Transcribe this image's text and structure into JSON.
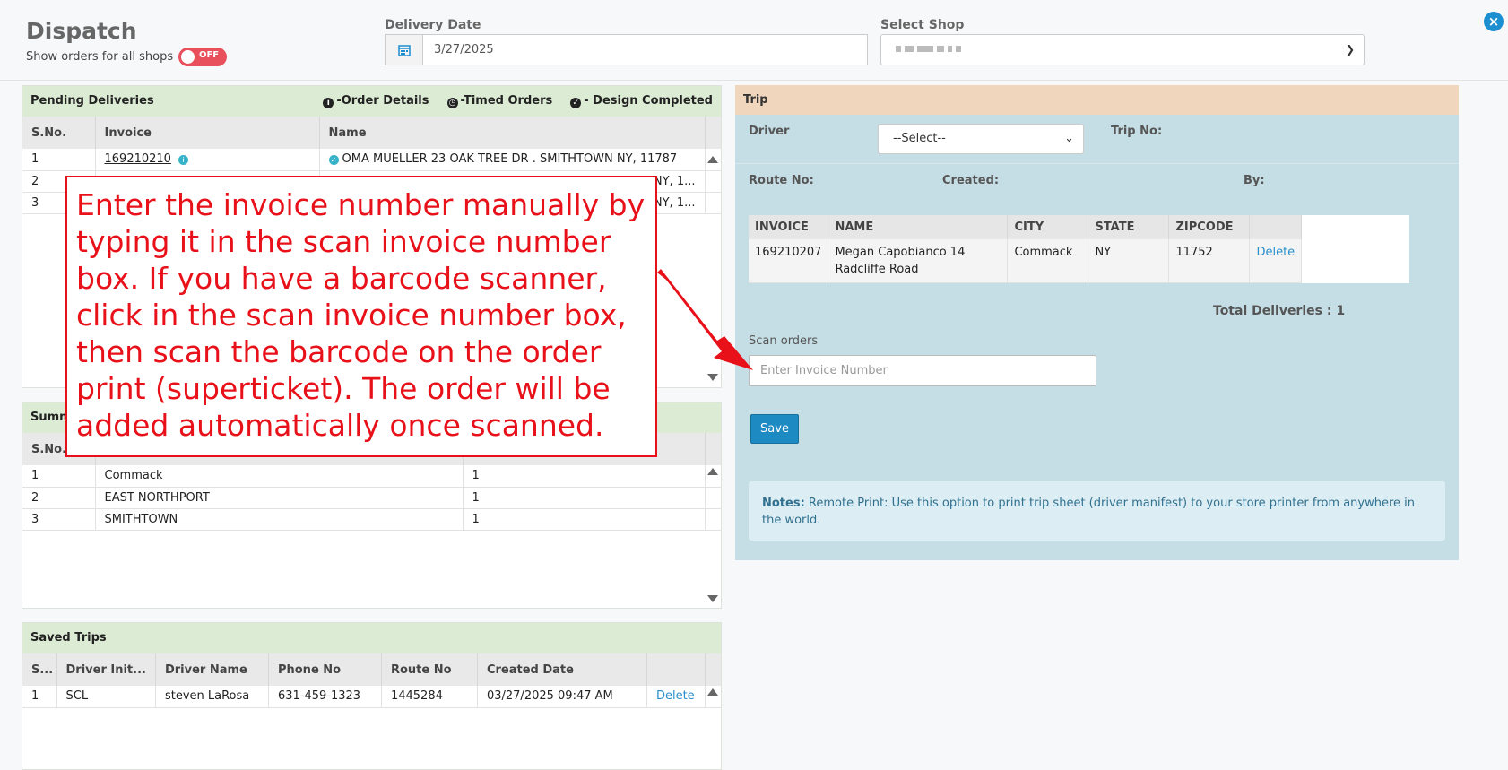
{
  "header": {
    "title": "Dispatch",
    "toggle_label": "Show orders for all shops",
    "toggle_state": "OFF",
    "delivery_date_label": "Delivery Date",
    "delivery_date_value": "3/27/2025",
    "select_shop_label": "Select Shop"
  },
  "pending": {
    "title": "Pending Deliveries",
    "legend": [
      "-Order Details",
      "-Timed Orders",
      "- Design Completed"
    ],
    "columns": [
      "S.No.",
      "Invoice",
      "Name"
    ],
    "rows": [
      {
        "sno": "1",
        "invoice": "169210210",
        "name": "OMA MUELLER 23 OAK TREE DR . SMITHTOWN NY, 11787"
      },
      {
        "sno": "2",
        "invoice": "",
        "name": "NY, 1..."
      },
      {
        "sno": "3",
        "invoice": "",
        "name": "NY, 1..."
      }
    ]
  },
  "summary": {
    "title": "Summ",
    "columns": [
      "S.No."
    ],
    "rows": [
      {
        "sno": "1",
        "city": "Commack",
        "count": "1"
      },
      {
        "sno": "2",
        "city": "EAST NORTHPORT",
        "count": "1"
      },
      {
        "sno": "3",
        "city": "SMITHTOWN",
        "count": "1"
      }
    ]
  },
  "saved_trips": {
    "title": "Saved Trips",
    "columns": [
      "S...",
      "Driver Init...",
      "Driver Name",
      "Phone No",
      "Route No",
      "Created Date"
    ],
    "rows": [
      {
        "sno": "1",
        "initials": "SCL",
        "driver": "steven LaRosa",
        "phone": "631-459-1323",
        "route": "1445284",
        "created": "03/27/2025 09:47 AM",
        "action": "Delete"
      }
    ]
  },
  "trip": {
    "title": "Trip",
    "driver_label": "Driver",
    "driver_value": "--Select--",
    "trip_no_label": "Trip No:",
    "route_no_label": "Route No:",
    "created_label": "Created:",
    "by_label": "By:",
    "columns": [
      "INVOICE",
      "NAME",
      "CITY",
      "STATE",
      "ZIPCODE"
    ],
    "rows": [
      {
        "invoice": "169210207",
        "name": "Megan Capobianco 14 Radcliffe Road",
        "city": "Commack",
        "state": "NY",
        "zip": "11752",
        "action": "Delete"
      }
    ],
    "total": "Total Deliveries : 1",
    "scan_label": "Scan orders",
    "scan_placeholder": "Enter Invoice Number",
    "save_label": "Save",
    "notes_bold": "Notes:",
    "notes_text": " Remote Print: Use this option to print trip sheet (driver manifest) to your store printer from anywhere in the world."
  },
  "callout": {
    "text": "Enter the invoice number manually by typing it in the scan invoice number box. If you have a barcode scanner, click in the scan invoice number box, then scan the barcode on the order print (superticket). The order will be added automatically once scanned."
  },
  "colors": {
    "accent": "#1d8ed0",
    "panel_header_green": "#dcebd3",
    "trip_header": "#efd6bd",
    "trip_body": "#c5dde4",
    "callout_red": "#e8111a"
  }
}
